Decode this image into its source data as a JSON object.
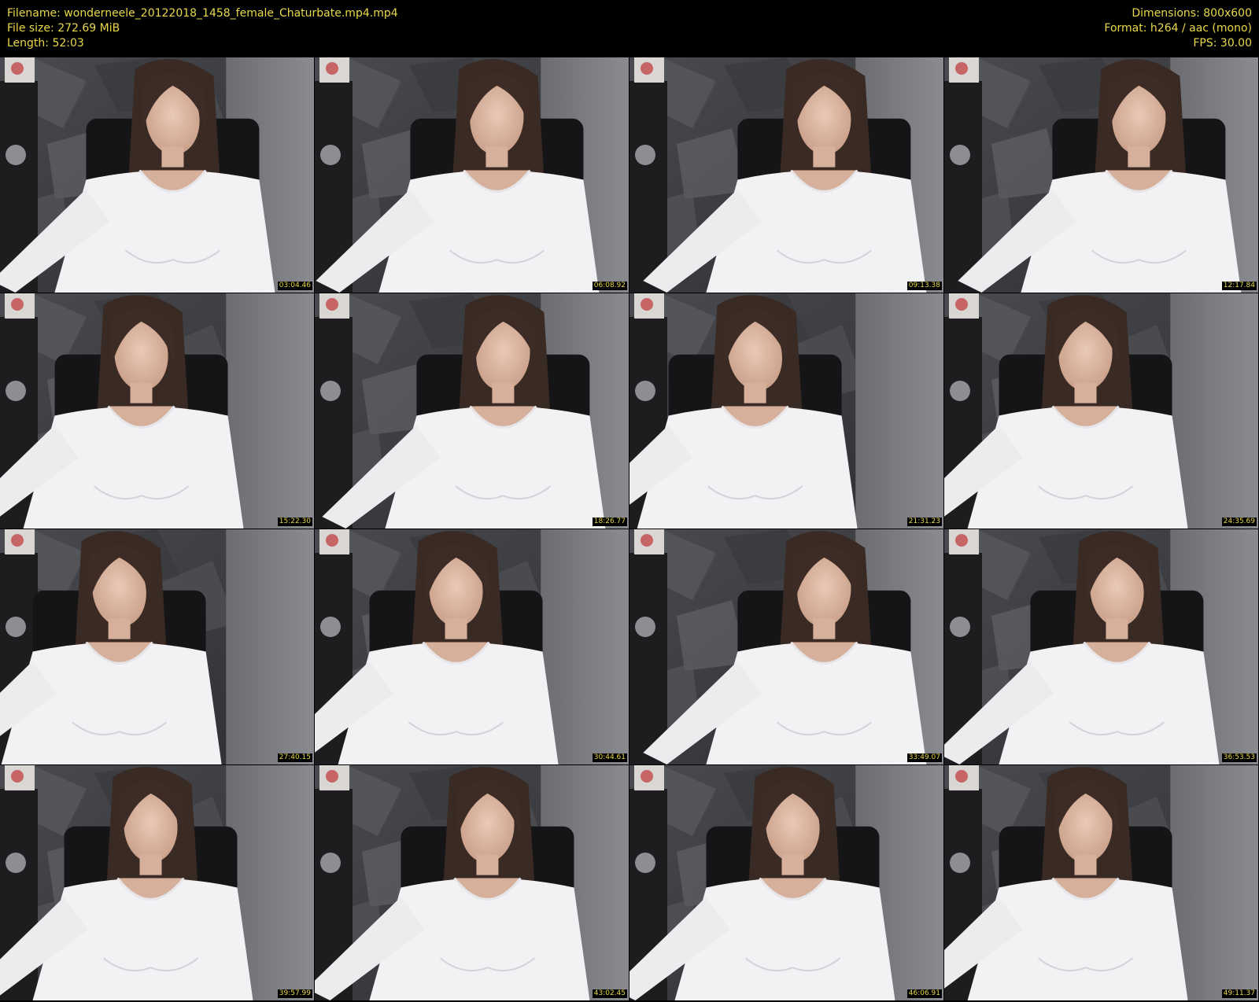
{
  "header": {
    "filename_line": "Filename: wonderneele_20122018_1458_female_Chaturbate.mp4.mp4",
    "filesize_line": "File size: 272.69 MiB",
    "length_line": "Length: 52:03",
    "dimensions_line": "Dimensions: 800x600",
    "format_line": "Format: h264 / aac (mono)",
    "fps_line": "FPS: 30.00",
    "text_color": "#e8d84a"
  },
  "thumbnails": [
    {
      "timestamp": "03:04.46"
    },
    {
      "timestamp": "06:08.92"
    },
    {
      "timestamp": "09:13.38"
    },
    {
      "timestamp": "12:17.84"
    },
    {
      "timestamp": "15:22.30"
    },
    {
      "timestamp": "18:26.77"
    },
    {
      "timestamp": "21:31.23"
    },
    {
      "timestamp": "24:35.69"
    },
    {
      "timestamp": "27:40.15"
    },
    {
      "timestamp": "30:44.61"
    },
    {
      "timestamp": "33:49.07"
    },
    {
      "timestamp": "36:53.53"
    },
    {
      "timestamp": "39:57.99"
    },
    {
      "timestamp": "43:02.45"
    },
    {
      "timestamp": "46:06.91"
    },
    {
      "timestamp": "49:11.37"
    }
  ]
}
